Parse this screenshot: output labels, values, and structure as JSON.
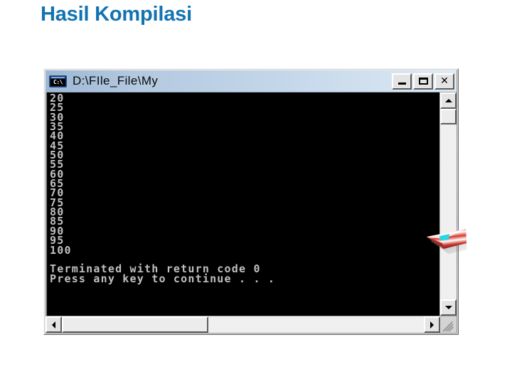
{
  "slide": {
    "title": "Hasil Kompilasi",
    "title_color": "#1273b2",
    "background_color": "#ffffff"
  },
  "console_window": {
    "titlebar": {
      "icon_name": "console-prompt-icon",
      "icon_text": "C:\\",
      "title": "D:\\FIle_File\\My",
      "buttons": {
        "minimize_label": "_",
        "maximize_label": "□",
        "close_label": "✕"
      }
    },
    "console": {
      "background_color": "#000000",
      "text_color": "#c0c0c0",
      "lines": [
        "20",
        "25",
        "30",
        "35",
        "40",
        "45",
        "50",
        "55",
        "60",
        "65",
        "70",
        "75",
        "80",
        "85",
        "90",
        "95",
        "100",
        "",
        "Terminated with return code 0",
        "Press any key to continue . . ."
      ]
    },
    "scrollbars": {
      "vertical": {
        "up_arrow": "scroll-up-arrow-icon",
        "down_arrow": "scroll-down-arrow-icon",
        "thumb_position": "top"
      },
      "horizontal": {
        "left_arrow": "scroll-left-arrow-icon",
        "right_arrow": "scroll-right-arrow-icon",
        "thumb_position": "left"
      },
      "resize_grip": "resize-grip-icon"
    }
  },
  "decoration": {
    "arrow_graphic": "red-striped-arrow-graphic",
    "arrow_colors": [
      "#d93a2f",
      "#ffffff",
      "#27d7e8"
    ]
  }
}
